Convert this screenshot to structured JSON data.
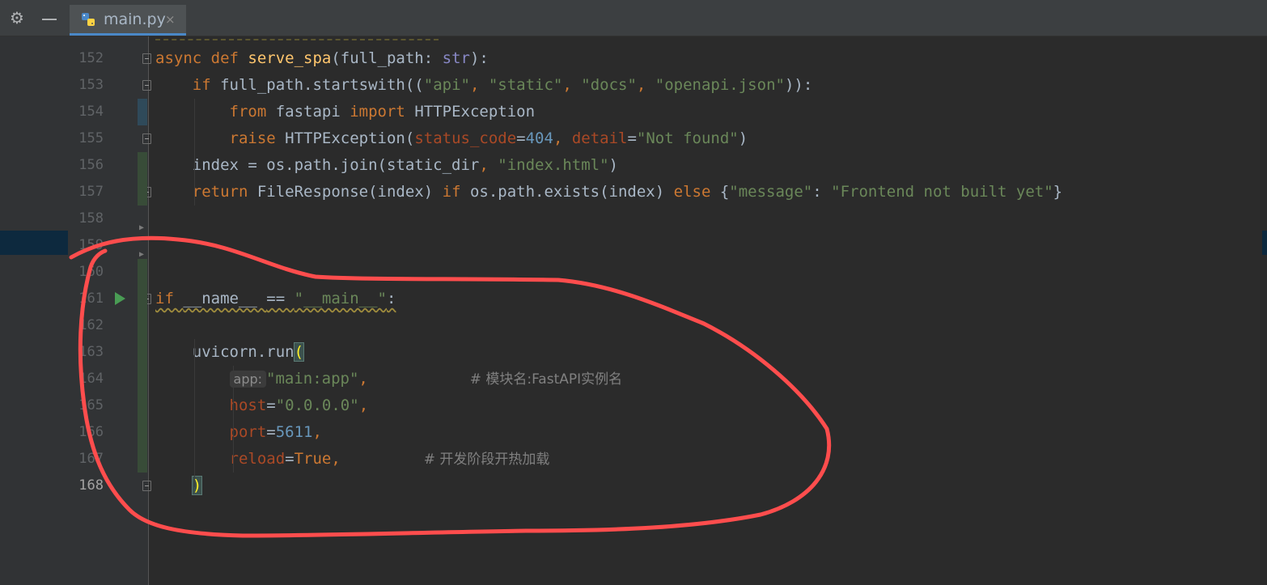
{
  "toolbar": {
    "settings_icon": "gear-icon",
    "collapse_icon": "minus-icon"
  },
  "tab": {
    "label": "main.py",
    "icon": "python-file-icon",
    "close": "×",
    "accent": "#4a88c7"
  },
  "editor": {
    "lines": [
      {
        "num": "152",
        "tokens": [
          {
            "t": "async ",
            "c": "kw"
          },
          {
            "t": "def ",
            "c": "kw"
          },
          {
            "t": "serve_spa",
            "c": "fn"
          },
          {
            "t": "(full_path: "
          },
          {
            "t": "str",
            "c": "bi"
          },
          {
            "t": "):"
          }
        ]
      },
      {
        "num": "153",
        "tokens": [
          {
            "t": "    "
          },
          {
            "t": "if ",
            "c": "kw"
          },
          {
            "t": "full_path.startswith(("
          },
          {
            "t": "\"api\"",
            "c": "str"
          },
          {
            "t": ", ",
            "c": "kw"
          },
          {
            "t": "\"static\"",
            "c": "str"
          },
          {
            "t": ", ",
            "c": "kw"
          },
          {
            "t": "\"docs\"",
            "c": "str"
          },
          {
            "t": ", ",
            "c": "kw"
          },
          {
            "t": "\"openapi.json\"",
            "c": "str"
          },
          {
            "t": ")):"
          }
        ]
      },
      {
        "num": "154",
        "tokens": [
          {
            "t": "        "
          },
          {
            "t": "from ",
            "c": "kw"
          },
          {
            "t": "fastapi "
          },
          {
            "t": "import ",
            "c": "kw"
          },
          {
            "t": "HTTPException"
          }
        ]
      },
      {
        "num": "155",
        "tokens": [
          {
            "t": "        "
          },
          {
            "t": "raise ",
            "c": "kw"
          },
          {
            "t": "HTTPException("
          },
          {
            "t": "status_code",
            "c": "param"
          },
          {
            "t": "="
          },
          {
            "t": "404",
            "c": "num"
          },
          {
            "t": ", ",
            "c": "kw"
          },
          {
            "t": "detail",
            "c": "param"
          },
          {
            "t": "="
          },
          {
            "t": "\"Not found\"",
            "c": "str"
          },
          {
            "t": ")"
          }
        ]
      },
      {
        "num": "156",
        "tokens": [
          {
            "t": "    index = os.path.join(static_dir"
          },
          {
            "t": ", ",
            "c": "kw"
          },
          {
            "t": "\"index.html\"",
            "c": "str"
          },
          {
            "t": ")"
          }
        ]
      },
      {
        "num": "157",
        "tokens": [
          {
            "t": "    "
          },
          {
            "t": "return ",
            "c": "kw"
          },
          {
            "t": "FileResponse(index) "
          },
          {
            "t": "if ",
            "c": "kw"
          },
          {
            "t": "os.path.exists(index) "
          },
          {
            "t": "else ",
            "c": "kw"
          },
          {
            "t": "{"
          },
          {
            "t": "\"message\"",
            "c": "str"
          },
          {
            "t": ": "
          },
          {
            "t": "\"Frontend not built yet\"",
            "c": "str"
          },
          {
            "t": "}"
          }
        ]
      },
      {
        "num": "158",
        "tokens": []
      },
      {
        "num": "159",
        "tokens": []
      },
      {
        "num": "160",
        "tokens": []
      },
      {
        "num": "161",
        "tokens": [
          {
            "t": "if ",
            "c": "kw wavy"
          },
          {
            "t": "__name__ ",
            "c": "wavy"
          },
          {
            "t": "== ",
            "c": "wavy"
          },
          {
            "t": "\"__main__\"",
            "c": "str wavy"
          },
          {
            "t": ":",
            "c": "wavy"
          }
        ]
      },
      {
        "num": "162",
        "tokens": []
      },
      {
        "num": "163",
        "tokens": [
          {
            "t": "    uvicorn.run"
          },
          {
            "t": "(",
            "c": "bracket-hl"
          }
        ]
      },
      {
        "num": "164",
        "tokens": [
          {
            "t": "        "
          },
          {
            "t": "app:",
            "c": "hint"
          },
          {
            "t": "\"main:app\"",
            "c": "str"
          },
          {
            "t": ",           ",
            "c": "kw"
          },
          {
            "t": "# 模块名:FastAPI实例名",
            "c": "cmt"
          }
        ]
      },
      {
        "num": "165",
        "tokens": [
          {
            "t": "        "
          },
          {
            "t": "host",
            "c": "param"
          },
          {
            "t": "="
          },
          {
            "t": "\"0.0.0.0\"",
            "c": "str"
          },
          {
            "t": ",",
            "c": "kw"
          }
        ]
      },
      {
        "num": "166",
        "tokens": [
          {
            "t": "        "
          },
          {
            "t": "port",
            "c": "param"
          },
          {
            "t": "="
          },
          {
            "t": "5611",
            "c": "num"
          },
          {
            "t": ",",
            "c": "kw"
          }
        ]
      },
      {
        "num": "167",
        "tokens": [
          {
            "t": "        "
          },
          {
            "t": "reload",
            "c": "param"
          },
          {
            "t": "="
          },
          {
            "t": "True",
            "c": "kw"
          },
          {
            "t": ",         ",
            "c": "kw"
          },
          {
            "t": "# 开发阶段开热加载",
            "c": "cmt"
          }
        ]
      },
      {
        "num": "168",
        "tokens": [
          {
            "t": "    "
          },
          {
            "t": ")",
            "c": "bracket-hl"
          }
        ]
      }
    ]
  },
  "annotation": {
    "color": "#ff4d4d",
    "shape": "hand-drawn-circle"
  },
  "colors": {
    "background": "#2b2b2b",
    "gutter": "#313335",
    "keyword": "#cc7832",
    "string": "#6a8759",
    "number": "#6897bb"
  }
}
